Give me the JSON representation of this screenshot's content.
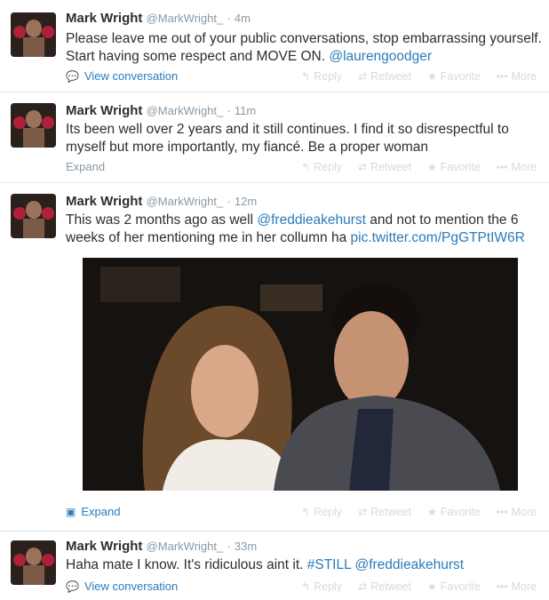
{
  "tweets": [
    {
      "name": "Mark Wright",
      "handle": "@MarkWright_",
      "sep": "·",
      "time": "4m",
      "text_parts": [
        "Please leave me out of your public conversations, stop embarrassing yourself. Start having some respect and MOVE ON. ",
        "@laurengoodger"
      ],
      "meta_label": "View conversation"
    },
    {
      "name": "Mark Wright",
      "handle": "@MarkWright_",
      "sep": "·",
      "time": "11m",
      "text": "Its been well over 2 years and it still continues. I find it so disrespectful to myself but more importantly, my fiancé. Be a proper woman",
      "meta_label": "Expand"
    },
    {
      "name": "Mark Wright",
      "handle": "@MarkWright_",
      "sep": "·",
      "time": "12m",
      "text_parts": [
        "This was 2 months ago as well ",
        "@freddieakehurst",
        " and not to mention the 6 weeks of her mentioning me in her collumn ha ",
        "pic.twitter.com/PgGTPtIW6R"
      ],
      "meta_label": "Expand"
    },
    {
      "name": "Mark Wright",
      "handle": "@MarkWright_",
      "sep": "·",
      "time": "33m",
      "text_parts": [
        "Haha mate I know. It's ridiculous aint it. ",
        "#STILL",
        " ",
        "@freddieakehurst"
      ],
      "meta_label": "View conversation"
    }
  ],
  "actions": {
    "reply": "Reply",
    "retweet": "Retweet",
    "favorite": "Favorite",
    "more": "More"
  },
  "icons": {
    "reply": "reply-icon",
    "retweet": "retweet-icon",
    "favorite": "star-icon",
    "more": "more-dots-icon",
    "conversation": "speech-bubble-icon",
    "expand": "media-expand-icon"
  },
  "colors": {
    "link": "#2b7bb9",
    "muted": "#8899a6",
    "faint_action": "#d3dbe2",
    "text": "#292f33"
  }
}
